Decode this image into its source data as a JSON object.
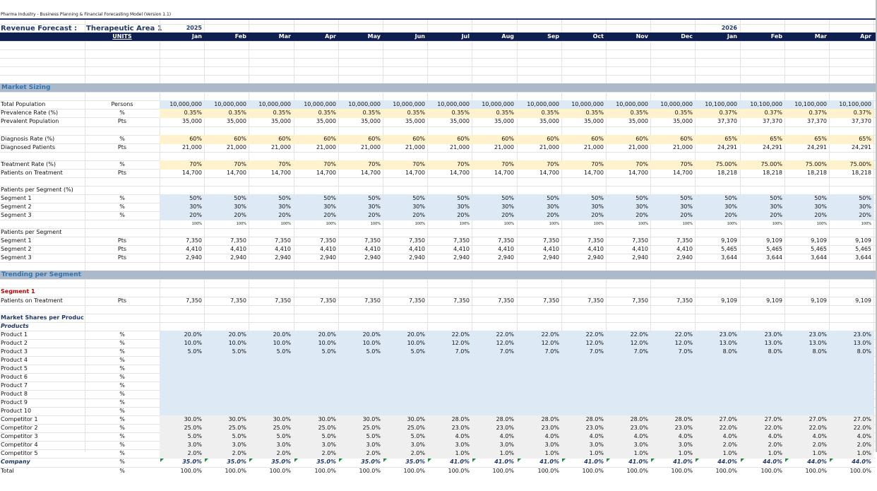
{
  "doc_title": "Pharma Industry - Business Planning & Financial Forecasting Model (Version 1.1)",
  "revenue_label": "Revenue Forecast :",
  "therapeutic_area": "Therapeutic Area 1",
  "units_header": "UNITS",
  "years": [
    {
      "col": 0,
      "label": "2025"
    },
    {
      "col": 12,
      "label": "2026"
    }
  ],
  "months": [
    "Jan",
    "Feb",
    "Mar",
    "Apr",
    "May",
    "Jun",
    "Jul",
    "Aug",
    "Sep",
    "Oct",
    "Nov",
    "Dec",
    "Jan",
    "Feb",
    "Mar",
    "Apr"
  ],
  "colors": {
    "navy": "#0f2050",
    "section": "#acb9ca",
    "peach": "#fff2cc",
    "blue": "#dde9f5",
    "gray": "#efefef",
    "segment_red": "#c00000",
    "marker_green": "#1e8e3e"
  },
  "sections": [
    {
      "row": 7,
      "label": "Market Sizing"
    },
    {
      "row": 29,
      "label": "Trending per Segment"
    }
  ],
  "rows": [
    {
      "row": 9,
      "label": "Total Population",
      "unit": "Persons",
      "band": "blue",
      "values": [
        "10,000,000",
        "10,000,000",
        "10,000,000",
        "10,000,000",
        "10,000,000",
        "10,000,000",
        "10,000,000",
        "10,000,000",
        "10,000,000",
        "10,000,000",
        "10,000,000",
        "10,000,000",
        "10,100,000",
        "10,100,000",
        "10,100,000",
        "10,100,000"
      ]
    },
    {
      "row": 10,
      "label": "Prevalence Rate (%)",
      "unit": "%",
      "band": "peach",
      "values": [
        "0.35%",
        "0.35%",
        "0.35%",
        "0.35%",
        "0.35%",
        "0.35%",
        "0.35%",
        "0.35%",
        "0.35%",
        "0.35%",
        "0.35%",
        "0.35%",
        "0.37%",
        "0.37%",
        "0.37%",
        "0.37%"
      ]
    },
    {
      "row": 11,
      "label": "Prevalent Population",
      "unit": "Pts",
      "values": [
        "35,000",
        "35,000",
        "35,000",
        "35,000",
        "35,000",
        "35,000",
        "35,000",
        "35,000",
        "35,000",
        "35,000",
        "35,000",
        "35,000",
        "37,370",
        "37,370",
        "37,370",
        "37,370"
      ]
    },
    {
      "row": 13,
      "label": "Diagnosis Rate (%)",
      "unit": "%",
      "band": "peach",
      "values": [
        "60%",
        "60%",
        "60%",
        "60%",
        "60%",
        "60%",
        "60%",
        "60%",
        "60%",
        "60%",
        "60%",
        "60%",
        "65%",
        "65%",
        "65%",
        "65%"
      ]
    },
    {
      "row": 14,
      "label": "Diagnosed Patients",
      "unit": "Pts",
      "values": [
        "21,000",
        "21,000",
        "21,000",
        "21,000",
        "21,000",
        "21,000",
        "21,000",
        "21,000",
        "21,000",
        "21,000",
        "21,000",
        "21,000",
        "24,291",
        "24,291",
        "24,291",
        "24,291"
      ]
    },
    {
      "row": 16,
      "label": "Treatment Rate (%)",
      "unit": "%",
      "band": "peach",
      "values": [
        "70%",
        "70%",
        "70%",
        "70%",
        "70%",
        "70%",
        "70%",
        "70%",
        "70%",
        "70%",
        "70%",
        "70%",
        "75.00%",
        "75.00%",
        "75.00%",
        "75.00%"
      ]
    },
    {
      "row": 17,
      "label": "Patients on Treatment",
      "unit": "Pts",
      "values": [
        "14,700",
        "14,700",
        "14,700",
        "14,700",
        "14,700",
        "14,700",
        "14,700",
        "14,700",
        "14,700",
        "14,700",
        "14,700",
        "14,700",
        "18,218",
        "18,218",
        "18,218",
        "18,218"
      ]
    },
    {
      "row": 19,
      "label": "Patients per Segment (%)",
      "unit": ""
    },
    {
      "row": 20,
      "label": "Segment 1",
      "unit": "%",
      "band": "blue",
      "values": [
        "50%",
        "50%",
        "50%",
        "50%",
        "50%",
        "50%",
        "50%",
        "50%",
        "50%",
        "50%",
        "50%",
        "50%",
        "50%",
        "50%",
        "50%",
        "50%"
      ]
    },
    {
      "row": 21,
      "label": "Segment 2",
      "unit": "%",
      "band": "blue",
      "values": [
        "30%",
        "30%",
        "30%",
        "30%",
        "30%",
        "30%",
        "30%",
        "30%",
        "30%",
        "30%",
        "30%",
        "30%",
        "30%",
        "30%",
        "30%",
        "30%"
      ]
    },
    {
      "row": 22,
      "label": "Segment 3",
      "unit": "%",
      "band": "blue",
      "values": [
        "20%",
        "20%",
        "20%",
        "20%",
        "20%",
        "20%",
        "20%",
        "20%",
        "20%",
        "20%",
        "20%",
        "20%",
        "20%",
        "20%",
        "20%",
        "20%"
      ]
    },
    {
      "row": 23,
      "label": "",
      "unit": "",
      "small": true,
      "values": [
        "100%",
        "100%",
        "100%",
        "100%",
        "100%",
        "100%",
        "100%",
        "100%",
        "100%",
        "100%",
        "100%",
        "100%",
        "100%",
        "100%",
        "100%",
        "100%"
      ]
    },
    {
      "row": 24,
      "label": "Patients per Segment",
      "unit": ""
    },
    {
      "row": 25,
      "label": "Segment 1",
      "unit": "Pts",
      "values": [
        "7,350",
        "7,350",
        "7,350",
        "7,350",
        "7,350",
        "7,350",
        "7,350",
        "7,350",
        "7,350",
        "7,350",
        "7,350",
        "7,350",
        "9,109",
        "9,109",
        "9,109",
        "9,109"
      ]
    },
    {
      "row": 26,
      "label": "Segment 2",
      "unit": "Pts",
      "values": [
        "4,410",
        "4,410",
        "4,410",
        "4,410",
        "4,410",
        "4,410",
        "4,410",
        "4,410",
        "4,410",
        "4,410",
        "4,410",
        "4,410",
        "5,465",
        "5,465",
        "5,465",
        "5,465"
      ]
    },
    {
      "row": 27,
      "label": "Segment 3",
      "unit": "Pts",
      "values": [
        "2,940",
        "2,940",
        "2,940",
        "2,940",
        "2,940",
        "2,940",
        "2,940",
        "2,940",
        "2,940",
        "2,940",
        "2,940",
        "2,940",
        "3,644",
        "3,644",
        "3,644",
        "3,644"
      ]
    },
    {
      "row": 31,
      "label": "Segment 1",
      "unit": "",
      "style": "red"
    },
    {
      "row": 32,
      "label": "Patients on Treatment",
      "unit": "Pts",
      "values": [
        "7,350",
        "7,350",
        "7,350",
        "7,350",
        "7,350",
        "7,350",
        "7,350",
        "7,350",
        "7,350",
        "7,350",
        "7,350",
        "7,350",
        "9,109",
        "9,109",
        "9,109",
        "9,109"
      ]
    },
    {
      "row": 34,
      "label": "Market Shares per Product",
      "unit": "",
      "style": "navy"
    },
    {
      "row": 35,
      "label": "Products",
      "unit": "",
      "style": "navyital"
    },
    {
      "row": 36,
      "label": "Product 1",
      "unit": "%",
      "band": "blue",
      "values": [
        "20.0%",
        "20.0%",
        "20.0%",
        "20.0%",
        "20.0%",
        "20.0%",
        "22.0%",
        "22.0%",
        "22.0%",
        "22.0%",
        "22.0%",
        "22.0%",
        "23.0%",
        "23.0%",
        "23.0%",
        "23.0%"
      ]
    },
    {
      "row": 37,
      "label": "Product 2",
      "unit": "%",
      "band": "blue",
      "values": [
        "10.0%",
        "10.0%",
        "10.0%",
        "10.0%",
        "10.0%",
        "10.0%",
        "12.0%",
        "12.0%",
        "12.0%",
        "12.0%",
        "12.0%",
        "12.0%",
        "13.0%",
        "13.0%",
        "13.0%",
        "13.0%"
      ]
    },
    {
      "row": 38,
      "label": "Product 3",
      "unit": "%",
      "band": "blue",
      "values": [
        "5.0%",
        "5.0%",
        "5.0%",
        "5.0%",
        "5.0%",
        "5.0%",
        "7.0%",
        "7.0%",
        "7.0%",
        "7.0%",
        "7.0%",
        "7.0%",
        "8.0%",
        "8.0%",
        "8.0%",
        "8.0%"
      ]
    },
    {
      "row": 39,
      "label": "Product 4",
      "unit": "%",
      "band": "blue"
    },
    {
      "row": 40,
      "label": "Product 5",
      "unit": "%",
      "band": "blue"
    },
    {
      "row": 41,
      "label": "Product 6",
      "unit": "%",
      "band": "blue"
    },
    {
      "row": 42,
      "label": "Product 7",
      "unit": "%",
      "band": "blue"
    },
    {
      "row": 43,
      "label": "Product 8",
      "unit": "%",
      "band": "blue"
    },
    {
      "row": 44,
      "label": "Product 9",
      "unit": "%",
      "band": "blue"
    },
    {
      "row": 45,
      "label": "Product 10",
      "unit": "%",
      "band": "blue"
    },
    {
      "row": 46,
      "label": "Competitor 1",
      "unit": "%",
      "band": "gray",
      "values": [
        "30.0%",
        "30.0%",
        "30.0%",
        "30.0%",
        "30.0%",
        "30.0%",
        "28.0%",
        "28.0%",
        "28.0%",
        "28.0%",
        "28.0%",
        "28.0%",
        "27.0%",
        "27.0%",
        "27.0%",
        "27.0%"
      ]
    },
    {
      "row": 47,
      "label": "Competitor 2",
      "unit": "%",
      "band": "gray",
      "values": [
        "25.0%",
        "25.0%",
        "25.0%",
        "25.0%",
        "25.0%",
        "25.0%",
        "23.0%",
        "23.0%",
        "23.0%",
        "23.0%",
        "23.0%",
        "23.0%",
        "22.0%",
        "22.0%",
        "22.0%",
        "22.0%"
      ]
    },
    {
      "row": 48,
      "label": "Competitor 3",
      "unit": "%",
      "band": "gray",
      "values": [
        "5.0%",
        "5.0%",
        "5.0%",
        "5.0%",
        "5.0%",
        "5.0%",
        "4.0%",
        "4.0%",
        "4.0%",
        "4.0%",
        "4.0%",
        "4.0%",
        "4.0%",
        "4.0%",
        "4.0%",
        "4.0%"
      ]
    },
    {
      "row": 49,
      "label": "Competitor 4",
      "unit": "%",
      "band": "gray",
      "values": [
        "3.0%",
        "3.0%",
        "3.0%",
        "3.0%",
        "3.0%",
        "3.0%",
        "3.0%",
        "3.0%",
        "3.0%",
        "3.0%",
        "3.0%",
        "3.0%",
        "2.0%",
        "2.0%",
        "2.0%",
        "2.0%"
      ]
    },
    {
      "row": 50,
      "label": "Competitor 5",
      "unit": "%",
      "band": "gray",
      "values": [
        "2.0%",
        "2.0%",
        "2.0%",
        "2.0%",
        "2.0%",
        "2.0%",
        "1.0%",
        "1.0%",
        "1.0%",
        "1.0%",
        "1.0%",
        "1.0%",
        "1.0%",
        "1.0%",
        "1.0%",
        "1.0%"
      ]
    },
    {
      "row": 51,
      "label": "Company",
      "unit": "%",
      "style": "company",
      "marker": true,
      "values": [
        "35.0%",
        "35.0%",
        "35.0%",
        "35.0%",
        "35.0%",
        "35.0%",
        "41.0%",
        "41.0%",
        "41.0%",
        "41.0%",
        "41.0%",
        "41.0%",
        "44.0%",
        "44.0%",
        "44.0%",
        "44.0%"
      ]
    },
    {
      "row": 52,
      "label": "Total",
      "unit": "%",
      "values": [
        "100.0%",
        "100.0%",
        "100.0%",
        "100.0%",
        "100.0%",
        "100.0%",
        "100.0%",
        "100.0%",
        "100.0%",
        "100.0%",
        "100.0%",
        "100.0%",
        "100.0%",
        "100.0%",
        "100.0%",
        "100.0%"
      ]
    }
  ]
}
